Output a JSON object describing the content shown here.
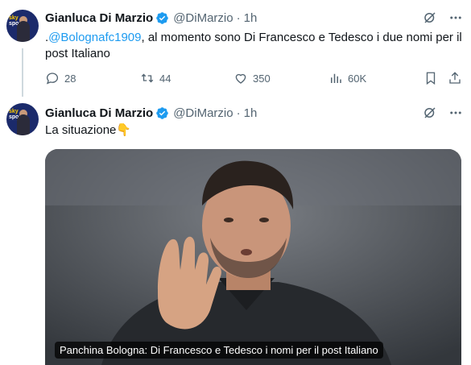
{
  "tweets": [
    {
      "author_name": "Gianluca Di Marzio",
      "handle": "@DiMarzio",
      "separator": "·",
      "time": "1h",
      "text_prefix": ".",
      "mention": "@Bolognafc1909",
      "text_rest": ", al momento sono Di Francesco e Tedesco i due nomi per il post Italiano",
      "replies": "28",
      "retweets": "44",
      "likes": "350",
      "views": "60K"
    },
    {
      "author_name": "Gianluca Di Marzio",
      "handle": "@DiMarzio",
      "separator": "·",
      "time": "1h",
      "text": "La situazione👇",
      "media_caption": "Panchina Bologna: Di Francesco e Tedesco i nomi per il post Italiano"
    }
  ],
  "avatar_logo": {
    "line1": "sky",
    "line2": "sport"
  },
  "colors": {
    "accent": "#1d9bf0",
    "secondary_text": "#536471",
    "verified": "#1d9bf0"
  }
}
